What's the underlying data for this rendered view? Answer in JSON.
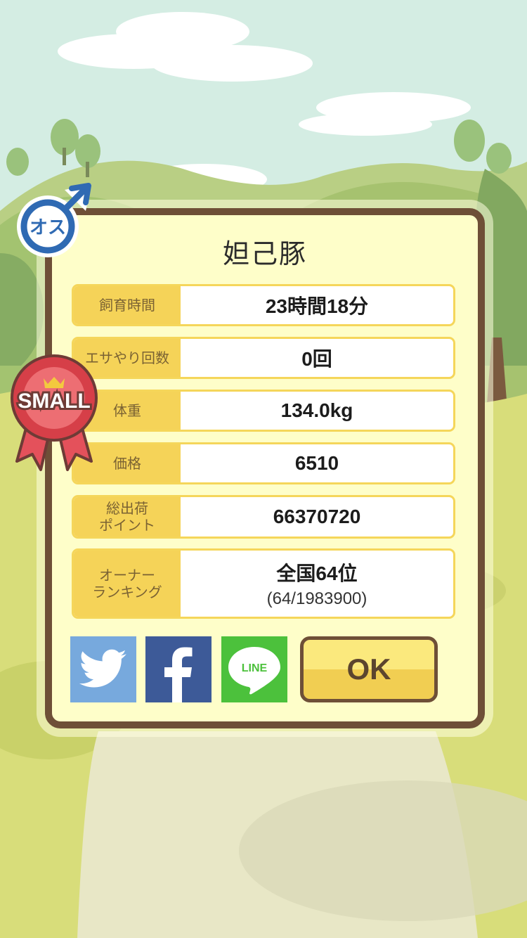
{
  "pig": {
    "name": "妲己豚"
  },
  "gender": {
    "label": "オス"
  },
  "size_badge": {
    "label": "SMALL"
  },
  "stats": [
    {
      "label": "飼育時間",
      "value": "23時間18分"
    },
    {
      "label": "エサやり回数",
      "value": "0回"
    },
    {
      "label": "体重",
      "value": "134.0kg"
    },
    {
      "label": "価格",
      "value": "6510"
    },
    {
      "label": "総出荷\nポイント",
      "value": "66370720"
    }
  ],
  "ranking": {
    "label": "オーナー\nランキング",
    "value": "全国64位",
    "detail": "(64/1983900)"
  },
  "share": {
    "line_label": "LINE"
  },
  "buttons": {
    "ok_label": "OK"
  },
  "icons": [
    "male-gender-icon",
    "twitter-icon",
    "facebook-icon",
    "line-icon",
    "ribbon-icon"
  ],
  "colors": {
    "panel_border": "#6e4f37",
    "panel_bg": "#fefec9",
    "label_bg": "#f5d358",
    "twitter": "#77a9dd",
    "facebook": "#3d5a98",
    "line": "#4cc13c"
  }
}
